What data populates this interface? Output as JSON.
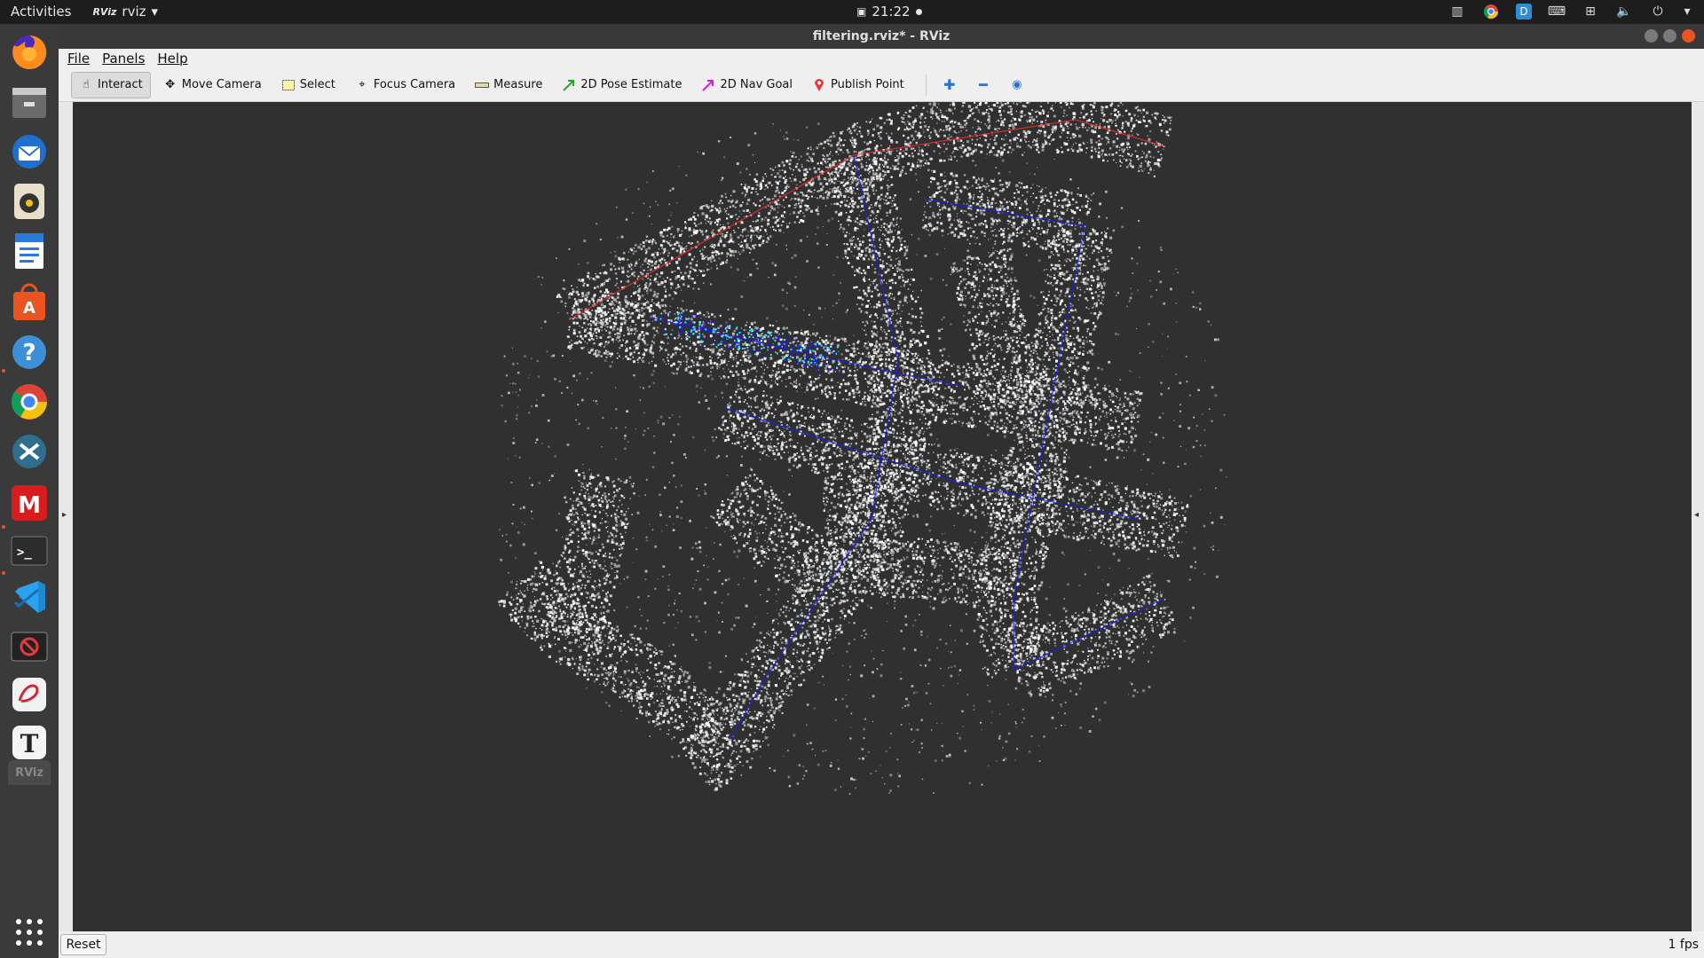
{
  "topbar": {
    "activities": "Activities",
    "app_name": "rviz",
    "app_icon_text": "RViz",
    "clock": "21:22"
  },
  "window": {
    "title": "filtering.rviz* - RViz"
  },
  "menu": {
    "file": "File",
    "panels": "Panels",
    "help": "Help"
  },
  "toolbar": {
    "interact": "Interact",
    "move_camera": "Move Camera",
    "select": "Select",
    "focus_camera": "Focus Camera",
    "measure": "Measure",
    "pose_estimate": "2D Pose Estimate",
    "nav_goal": "2D Nav Goal",
    "publish_point": "Publish Point"
  },
  "status": {
    "reset": "Reset",
    "fps": "1 fps"
  },
  "dock": {
    "items": [
      "firefox-icon",
      "files-icon",
      "thunderbird-icon",
      "rhythmbox-icon",
      "writer-icon",
      "software-icon",
      "help-icon",
      "chrome-icon",
      "xmind-icon",
      "mendeley-icon",
      "terminal-icon",
      "vscode-icon",
      "screen-recorder-icon",
      "zotero-icon",
      "typora-icon",
      "rviz-icon",
      "app-grid-icon"
    ]
  },
  "colors": {
    "accent": "#e95420",
    "viewport_bg": "#303030",
    "point_cloud": "#ffffff",
    "trajectory_blue": "#1a1aff",
    "trajectory_red": "#ff2a2a",
    "scan_cyan": "#2ee6ff"
  }
}
